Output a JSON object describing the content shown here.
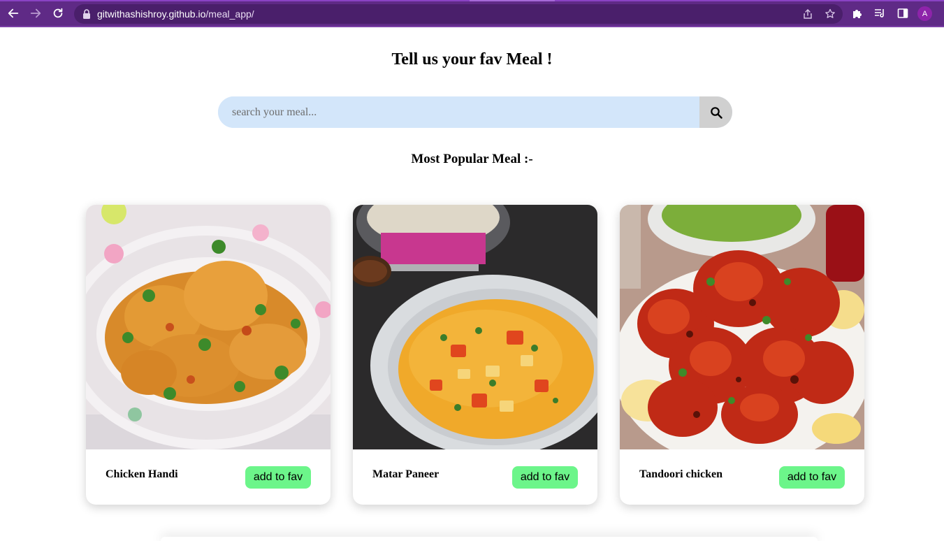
{
  "browser": {
    "url_host": "gitwithashishroy.github.io",
    "url_path": "/meal_app/",
    "profile_initial": "A",
    "frame_color": "#5f2a86"
  },
  "page": {
    "title": "Tell us your fav Meal !",
    "search": {
      "placeholder": "search your meal...",
      "value": ""
    },
    "section_title": "Most Popular Meal :-",
    "meals": [
      {
        "name": "Chicken Handi",
        "button_label": "add to fav"
      },
      {
        "name": "Matar Paneer",
        "button_label": "add to fav"
      },
      {
        "name": "Tandoori chicken",
        "button_label": "add to fav"
      }
    ],
    "colors": {
      "search_bg": "#d3e6fa",
      "search_button_bg": "#d0d0d0",
      "fav_button_bg": "#6cf58a"
    }
  }
}
